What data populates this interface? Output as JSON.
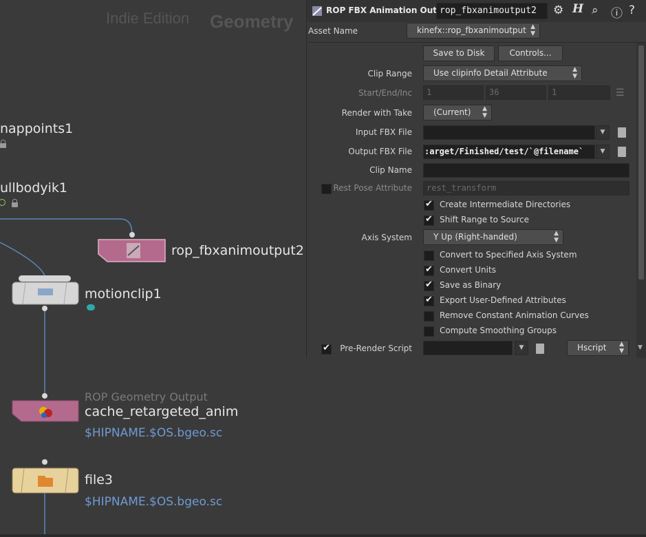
{
  "network": {
    "watermark_edition": "Indie Edition",
    "watermark_context": "Geometry",
    "nodes": {
      "snappoints": "nappoints1",
      "fullbodyik": "ullbodyik1",
      "rop_fbx": "rop_fbxanimoutput2",
      "motionclip": "motionclip1",
      "rop_geo_type": "ROP Geometry Output",
      "rop_geo": "cache_retargeted_anim",
      "rop_geo_expr": "$HIPNAME.$OS.bgeo.sc",
      "file": "file3",
      "file_expr": "$HIPNAME.$OS.bgeo.sc"
    }
  },
  "params": {
    "node_type": "ROP FBX Animation Output",
    "node_name": "rop_fbxanimoutput2",
    "asset_label": "Asset Name",
    "asset_value": "kinefx::rop_fbxanimoutput",
    "save_to_disk": "Save to Disk",
    "controls": "Controls...",
    "clip_range_label": "Clip Range",
    "clip_range_value": "Use clipinfo Detail Attribute",
    "sei_label": "Start/End/Inc",
    "sei_start": "1",
    "sei_end": "36",
    "sei_inc": "1",
    "take_label": "Render with Take",
    "take_value": "(Current)",
    "input_fbx_label": "Input FBX File",
    "input_fbx_value": "",
    "output_fbx_label": "Output FBX File",
    "output_fbx_value": ":arget/Finished/test/`@filename`",
    "clip_name_label": "Clip Name",
    "clip_name_value": "",
    "rest_pose_label": "Rest Pose Attribute",
    "rest_pose_placeholder": "rest_transform",
    "create_dirs": "Create Intermediate Directories",
    "shift_range": "Shift Range to Source",
    "axis_label": "Axis System",
    "axis_value": "Y Up (Right-handed)",
    "convert_axis": "Convert to Specified Axis System",
    "convert_units": "Convert Units",
    "save_binary": "Save as Binary",
    "export_user": "Export User-Defined Attributes",
    "remove_const": "Remove Constant Animation Curves",
    "compute_smooth": "Compute Smoothing Groups",
    "prerender_label": "Pre-Render Script",
    "prerender_lang": "Hscript"
  },
  "colors": {
    "rop_node": "#b46a8c",
    "file_node": "#e8d29b",
    "expression": "#6f9ad4",
    "wire": "#5a86b8"
  }
}
